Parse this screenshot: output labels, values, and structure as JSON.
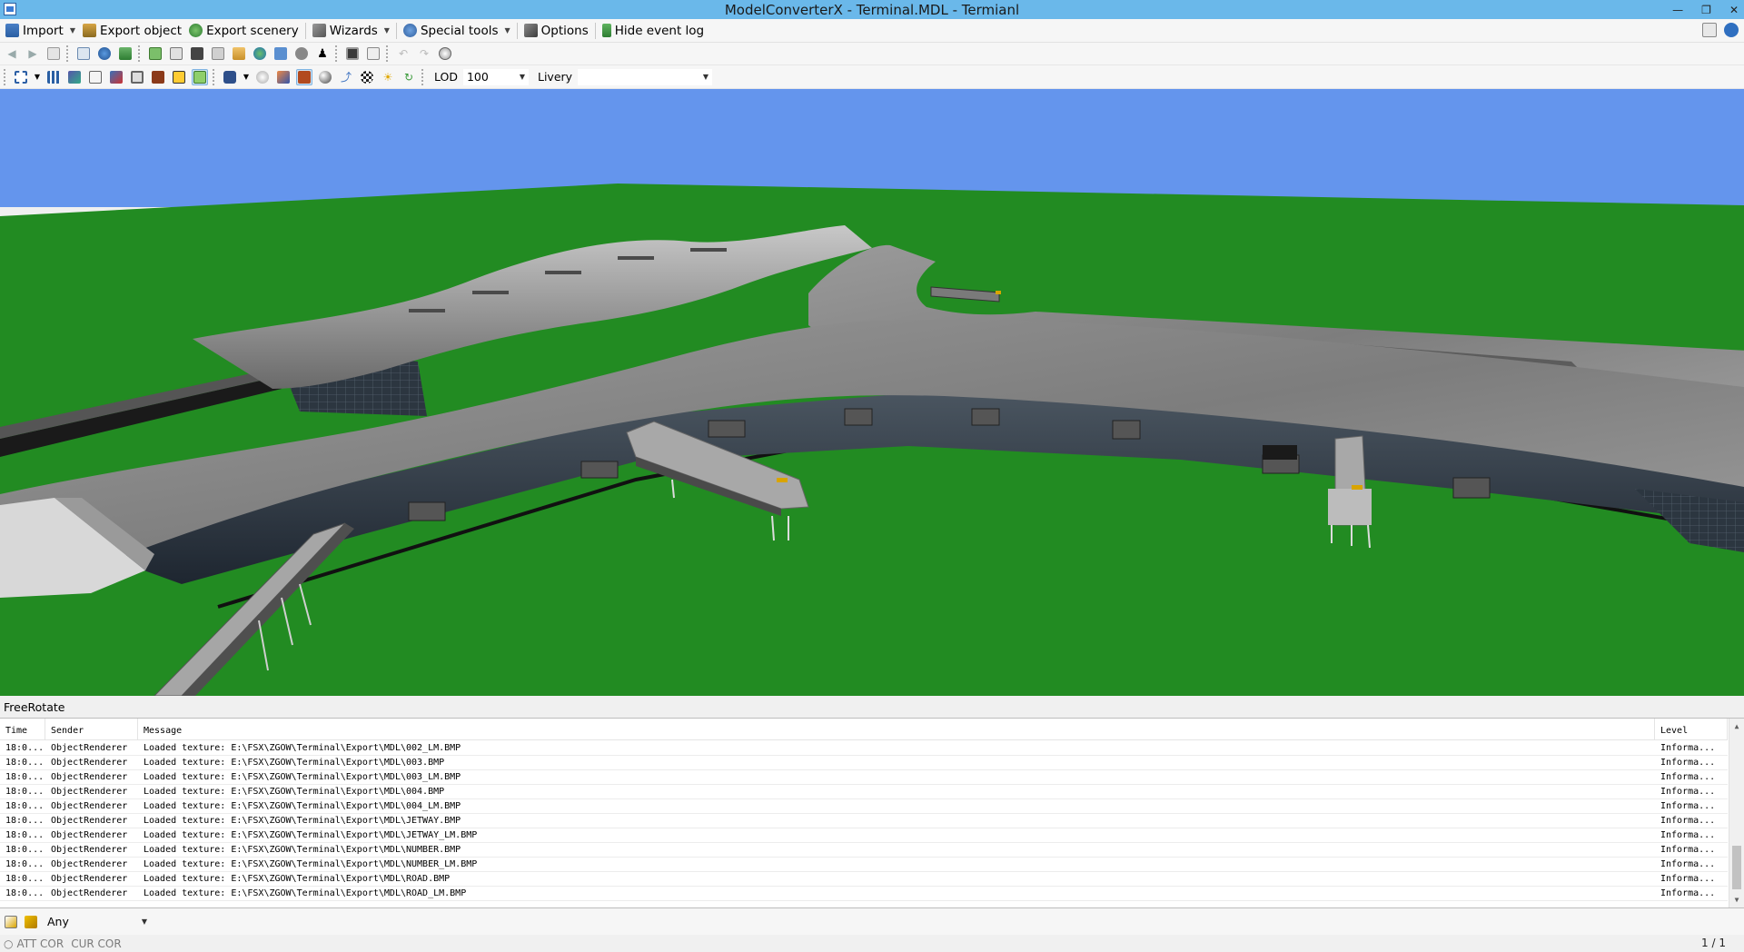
{
  "window": {
    "title": "ModelConverterX - Terminal.MDL - Termianl"
  },
  "menu": {
    "items": [
      {
        "label": "Import",
        "icon": "import-icon",
        "dropdown": true
      },
      {
        "label": "Export object",
        "icon": "export-object-icon",
        "dropdown": false
      },
      {
        "label": "Export scenery",
        "icon": "export-scenery-icon",
        "dropdown": false
      },
      {
        "label": "Wizards",
        "icon": "wizard-icon",
        "dropdown": true
      },
      {
        "label": "Special tools",
        "icon": "gear-icon",
        "dropdown": true
      },
      {
        "label": "Options",
        "icon": "tools-icon",
        "dropdown": false
      },
      {
        "label": "Hide event log",
        "icon": "event-log-icon",
        "dropdown": false
      }
    ]
  },
  "toolbar2": {
    "lod_label": "LOD",
    "lod_value": "100",
    "livery_label": "Livery",
    "livery_value": ""
  },
  "viewport": {
    "sky_color": "#6495ed",
    "ground_color": "#228b22"
  },
  "mode_label": "FreeRotate",
  "eventlog": {
    "columns": [
      "Time",
      "Sender",
      "Message",
      "Level"
    ],
    "rows": [
      {
        "time": "18:0...",
        "sender": "ObjectRenderer",
        "message": "Loaded texture: E:\\FSX\\ZGOW\\Terminal\\Export\\MDL\\002_LM.BMP",
        "level": "Informa..."
      },
      {
        "time": "18:0...",
        "sender": "ObjectRenderer",
        "message": "Loaded texture: E:\\FSX\\ZGOW\\Terminal\\Export\\MDL\\003.BMP",
        "level": "Informa..."
      },
      {
        "time": "18:0...",
        "sender": "ObjectRenderer",
        "message": "Loaded texture: E:\\FSX\\ZGOW\\Terminal\\Export\\MDL\\003_LM.BMP",
        "level": "Informa..."
      },
      {
        "time": "18:0...",
        "sender": "ObjectRenderer",
        "message": "Loaded texture: E:\\FSX\\ZGOW\\Terminal\\Export\\MDL\\004.BMP",
        "level": "Informa..."
      },
      {
        "time": "18:0...",
        "sender": "ObjectRenderer",
        "message": "Loaded texture: E:\\FSX\\ZGOW\\Terminal\\Export\\MDL\\004_LM.BMP",
        "level": "Informa..."
      },
      {
        "time": "18:0...",
        "sender": "ObjectRenderer",
        "message": "Loaded texture: E:\\FSX\\ZGOW\\Terminal\\Export\\MDL\\JETWAY.BMP",
        "level": "Informa..."
      },
      {
        "time": "18:0...",
        "sender": "ObjectRenderer",
        "message": "Loaded texture: E:\\FSX\\ZGOW\\Terminal\\Export\\MDL\\JETWAY_LM.BMP",
        "level": "Informa..."
      },
      {
        "time": "18:0...",
        "sender": "ObjectRenderer",
        "message": "Loaded texture: E:\\FSX\\ZGOW\\Terminal\\Export\\MDL\\NUMBER.BMP",
        "level": "Informa..."
      },
      {
        "time": "18:0...",
        "sender": "ObjectRenderer",
        "message": "Loaded texture: E:\\FSX\\ZGOW\\Terminal\\Export\\MDL\\NUMBER_LM.BMP",
        "level": "Informa..."
      },
      {
        "time": "18:0...",
        "sender": "ObjectRenderer",
        "message": "Loaded texture: E:\\FSX\\ZGOW\\Terminal\\Export\\MDL\\ROAD.BMP",
        "level": "Informa..."
      },
      {
        "time": "18:0...",
        "sender": "ObjectRenderer",
        "message": "Loaded texture: E:\\FSX\\ZGOW\\Terminal\\Export\\MDL\\ROAD_LM.BMP",
        "level": "Informa..."
      }
    ]
  },
  "filter": {
    "value": "Any"
  },
  "statusbar": {
    "att_cor": "ATT COR",
    "cur_cor": "CUR COR",
    "pager": "1 / 1"
  }
}
